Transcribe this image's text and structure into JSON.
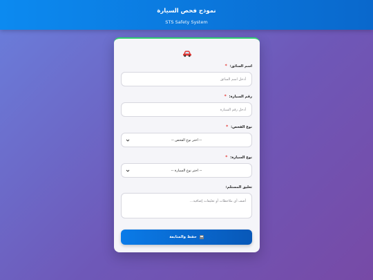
{
  "header": {
    "title": "نموذج فحص السيارة",
    "subtitle": "STS Safety System"
  },
  "form": {
    "icon": "car-icon",
    "driver_name": {
      "label": "اسم السائق:",
      "required_mark": "*",
      "placeholder": "أدخل اسم السائق"
    },
    "car_number": {
      "label": "رقم السيارة:",
      "required_mark": "*",
      "placeholder": "أدخل رقم السيارة"
    },
    "inspection_type": {
      "label": "نوع الفحص:",
      "required_mark": "*",
      "selected": "-- اختر نوع الفحص --"
    },
    "car_type": {
      "label": "نوع السيارة:",
      "required_mark": "*",
      "selected": "-- اختر نوع السيارة --"
    },
    "receiver_comment": {
      "label": "تعليق المستلم:",
      "placeholder": "أضف أي ملاحظات أو تعليقات إضافية..."
    },
    "save_label": "حفظ والمتابعة",
    "save_icon": "floppy-disk-icon"
  },
  "colors": {
    "header_gradient": [
      "#0c8af0",
      "#0a68cc"
    ],
    "button_gradient": [
      "#0a7be8",
      "#0858b8"
    ],
    "card_top_border": "#2ecc71",
    "required": "#e53935",
    "car": "#e53935"
  }
}
